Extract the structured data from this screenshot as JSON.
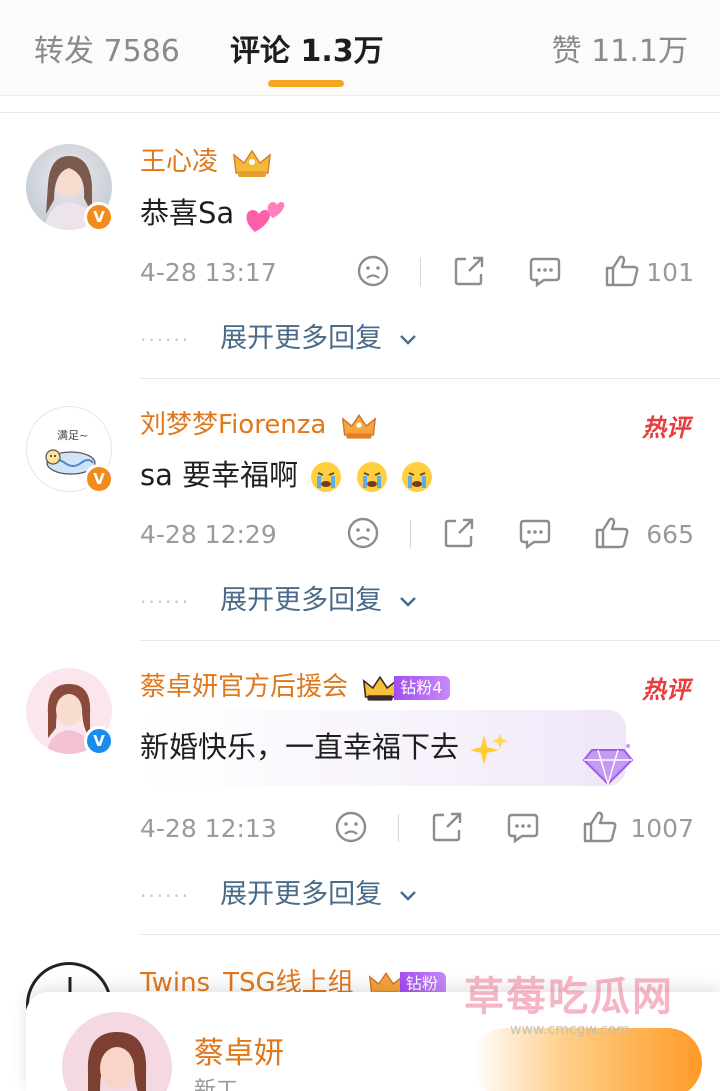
{
  "tabs": {
    "repost": "转发 7586",
    "comments": "评论 1.3万",
    "likes": "赞 11.1万"
  },
  "colors": {
    "accent": "#f5a623",
    "username": "#e0781b",
    "hot_label": "#e83d3d",
    "expand_link": "#4a6b8a"
  },
  "comments": [
    {
      "username": "王心凌",
      "verified_badge": "V",
      "text": "恭喜Sa",
      "text_emoji": "two-hearts",
      "hot_label": "",
      "time": "4-28 13:17",
      "likes": "101",
      "expand_label": "展开更多回复"
    },
    {
      "username": "刘梦梦Fiorenza",
      "verified_badge": "V",
      "avatar_caption": "满足~",
      "text": "sa 要幸福啊",
      "text_emoji": "crying-face ×3",
      "hot_label": "热评",
      "time": "4-28 12:29",
      "likes": "665",
      "expand_label": "展开更多回复"
    },
    {
      "username": "蔡卓妍官方后援会",
      "fan_badge": "钻粉4",
      "verified_badge": "V",
      "text": "新婚快乐，一直幸福下去",
      "text_emoji": "sparkles",
      "hot_label": "热评",
      "time": "4-28 12:13",
      "likes": "1007",
      "expand_label": "展开更多回复"
    },
    {
      "username": "Twins_TSG线上组",
      "fan_badge": "钻粉"
    }
  ],
  "popup": {
    "name": "蔡卓妍",
    "subtitle": "新工"
  },
  "watermark": {
    "text": "草莓吃瓜网",
    "url": "www.cmcgw.com"
  }
}
